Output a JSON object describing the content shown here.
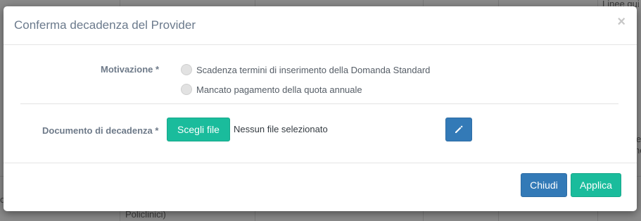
{
  "background": {
    "top_right_text": "Linee gui",
    "bottom_left_text": "Policlinici)",
    "right_edge_text_1": "e",
    "right_edge_text_2": "ne",
    "left_edge_text": "o"
  },
  "modal": {
    "title": "Conferma decadenza del Provider",
    "close_glyph": "×"
  },
  "form": {
    "motivation_label": "Motivazione *",
    "motivation_options": [
      {
        "label": "Scadenza termini di inserimento della Domanda Standard",
        "selected": false
      },
      {
        "label": "Mancato pagamento della quota annuale",
        "selected": false
      }
    ],
    "document_label": "Documento di decadenza *",
    "choose_file_label": "Scegli file",
    "file_status": "Nessun file selezionato",
    "edit_icon": "pencil-icon"
  },
  "footer": {
    "close_label": "Chiudi",
    "apply_label": "Applica"
  },
  "colors": {
    "primary": "#337ab7",
    "success": "#1abc9c",
    "title": "#6b7a8c"
  }
}
